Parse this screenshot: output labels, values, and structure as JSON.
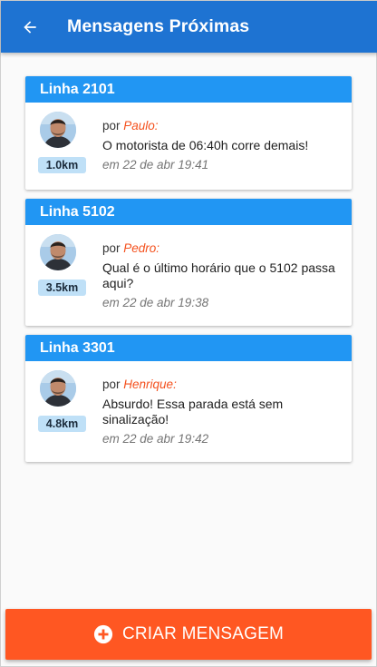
{
  "header": {
    "title": "Mensagens Próximas",
    "back_icon": "arrow-left-icon",
    "color": "#1e73d2"
  },
  "messages": [
    {
      "line": "Linha 2101",
      "distance": "1.0km",
      "by": "por",
      "author": "Paulo:",
      "text": "O motorista de 06:40h corre demais!",
      "date": "em 22 de abr 19:41"
    },
    {
      "line": "Linha 5102",
      "distance": "3.5km",
      "by": "por",
      "author": "Pedro:",
      "text": "Qual é o último horário que o 5102 passa aqui?",
      "date": "em 22 de abr 19:38"
    },
    {
      "line": "Linha 3301",
      "distance": "4.8km",
      "by": "por",
      "author": "Henrique:",
      "text": "Absurdo! Essa parada está sem sinalização!",
      "date": "em 22 de abr 19:42"
    }
  ],
  "create_button": {
    "label": "CRIAR MENSAGEM",
    "icon": "plus-circle-icon",
    "color": "#ff5722"
  },
  "colors": {
    "card_header": "#2196f3",
    "author": "#f4511e",
    "badge": "#bfe0f7"
  }
}
